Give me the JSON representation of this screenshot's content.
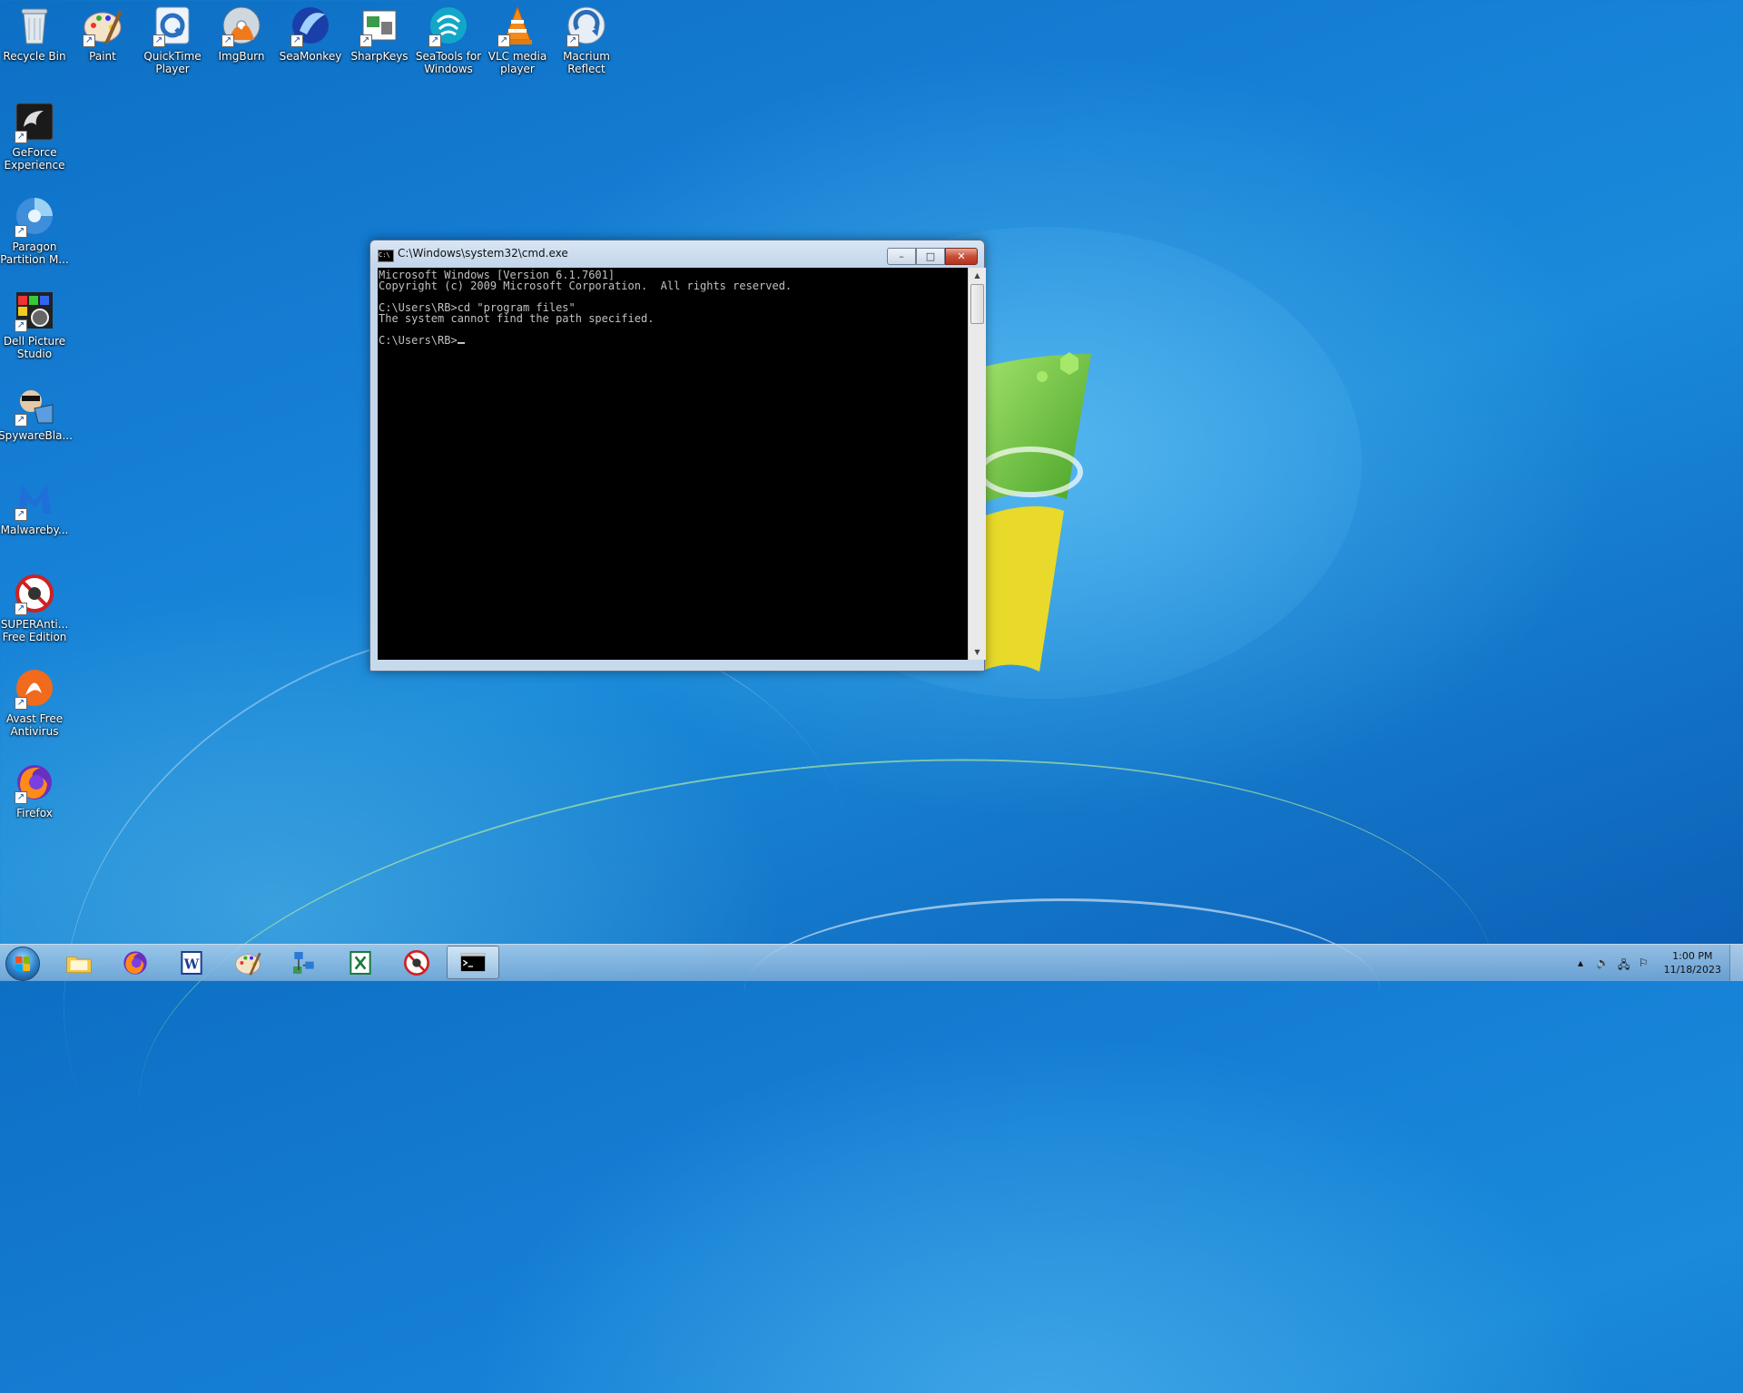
{
  "desktop": {
    "icons": [
      {
        "label": "Recycle Bin",
        "icon": "recycle-bin-icon"
      },
      {
        "label": "Paint",
        "icon": "paint-icon"
      },
      {
        "label": "QuickTime Player",
        "icon": "quicktime-icon"
      },
      {
        "label": "ImgBurn",
        "icon": "imgburn-icon"
      },
      {
        "label": "SeaMonkey",
        "icon": "seamonkey-icon"
      },
      {
        "label": "SharpKeys",
        "icon": "sharpkeys-icon"
      },
      {
        "label": "SeaTools for Windows",
        "icon": "seatools-icon"
      },
      {
        "label": "VLC media player",
        "icon": "vlc-icon"
      },
      {
        "label": "Macrium Reflect",
        "icon": "macrium-icon"
      },
      {
        "label": "GeForce Experience",
        "icon": "geforce-icon"
      },
      {
        "label": "Paragon Partition M...",
        "icon": "paragon-icon"
      },
      {
        "label": "Dell Picture Studio",
        "icon": "dell-picture-icon"
      },
      {
        "label": "SpywareBla...",
        "icon": "spywareblaster-icon"
      },
      {
        "label": "Malwareby...",
        "icon": "malwarebytes-icon"
      },
      {
        "label": "SUPERAnti... Free Edition",
        "icon": "superantispyware-icon"
      },
      {
        "label": "Avast Free Antivirus",
        "icon": "avast-icon"
      },
      {
        "label": "Firefox",
        "icon": "firefox-icon"
      }
    ]
  },
  "cmd_window": {
    "title": "C:\\Windows\\system32\\cmd.exe",
    "lines": [
      "Microsoft Windows [Version 6.1.7601]",
      "Copyright (c) 2009 Microsoft Corporation.  All rights reserved.",
      "",
      "C:\\Users\\RB>cd \"program files\"",
      "The system cannot find the path specified.",
      "",
      "C:\\Users\\RB>"
    ],
    "buttons": {
      "minimize": "–",
      "maximize": "□",
      "close": "✕"
    }
  },
  "taskbar": {
    "pinned": [
      {
        "name": "explorer",
        "icon": "folder-icon"
      },
      {
        "name": "firefox",
        "icon": "firefox-icon"
      },
      {
        "name": "word",
        "icon": "word-icon"
      },
      {
        "name": "paint",
        "icon": "paint-icon"
      },
      {
        "name": "network",
        "icon": "network-icon"
      },
      {
        "name": "excel",
        "icon": "excel-icon"
      },
      {
        "name": "superantispyware",
        "icon": "superantispyware-icon"
      },
      {
        "name": "cmd",
        "icon": "cmd-icon",
        "active": true
      }
    ],
    "clock_time": "1:00 PM",
    "clock_date": "11/18/2023"
  }
}
